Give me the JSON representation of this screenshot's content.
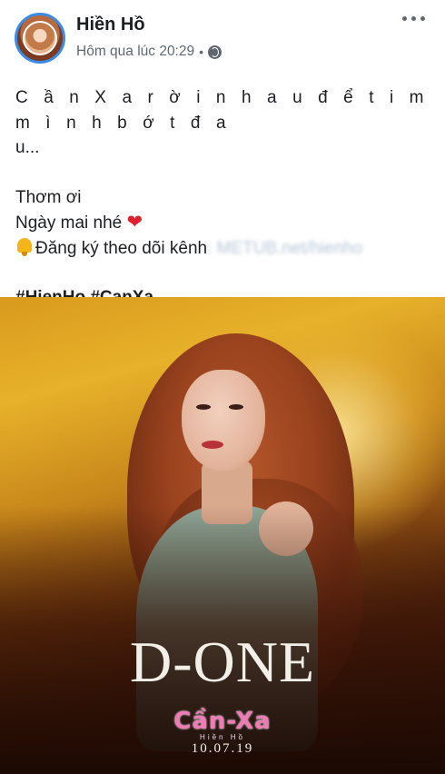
{
  "post": {
    "author": "Hiền Hồ",
    "timestamp": "Hôm qua lúc 20:29",
    "separator": "•",
    "audience_icon": "globe-icon",
    "menu_icon": "more-options-icon",
    "lines": {
      "l1": "C ầ n X a r ờ i n h a u đ ể t i m m ì n h b ớ t đ a",
      "l2": "u...",
      "l3": "Thơm ơi",
      "l4_text": "Ngày mai nhé",
      "l4_emoji": "❤",
      "l5_text": "Đăng ký theo dõi kênh",
      "l5_blurred": ": METUB.net/hienho"
    },
    "hashtags": "#HienHo #CanXa"
  },
  "photo": {
    "title": "D-ONE",
    "logo": "Cần-Xa",
    "logo_sub": "Hiền Hồ",
    "date": "10.07.19"
  }
}
